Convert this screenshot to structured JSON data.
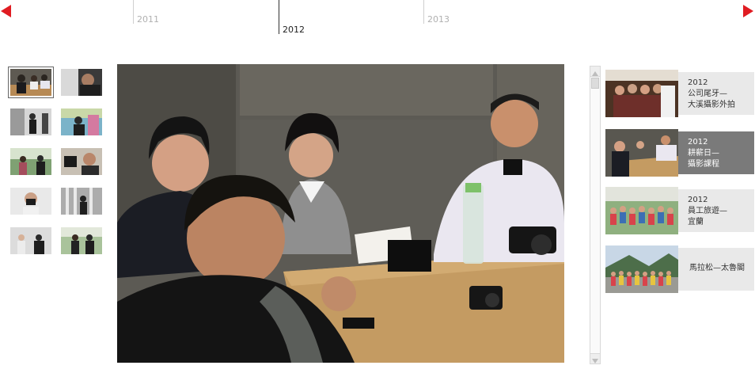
{
  "nav": {
    "prev_icon": "red-triangle-left",
    "next_icon": "red-triangle-right",
    "accent": "#e01c22"
  },
  "timeline": {
    "years": [
      "2011",
      "2012",
      "2013"
    ],
    "selected": "2012"
  },
  "thumbnails": [
    {
      "id": "t1",
      "selected": true
    },
    {
      "id": "t2"
    },
    {
      "id": "t3"
    },
    {
      "id": "t4"
    },
    {
      "id": "t5"
    },
    {
      "id": "t6"
    },
    {
      "id": "t7"
    },
    {
      "id": "t8"
    },
    {
      "id": "t9"
    },
    {
      "id": "t10"
    }
  ],
  "main_photo": {
    "subject": "meeting-photo"
  },
  "albums": [
    {
      "year": "2012",
      "title_line1": "公司尾牙—",
      "title_line2": "大溪攝影外拍",
      "active": false
    },
    {
      "year": "2012",
      "title_line1": "耕薪日—",
      "title_line2": "攝影課程",
      "active": true
    },
    {
      "year": "2012",
      "title_line1": "員工旅遊—",
      "title_line2": "宜蘭",
      "active": false
    },
    {
      "year": "",
      "title_line1": "馬拉松—太魯閣",
      "title_line2": "",
      "active": false
    }
  ]
}
